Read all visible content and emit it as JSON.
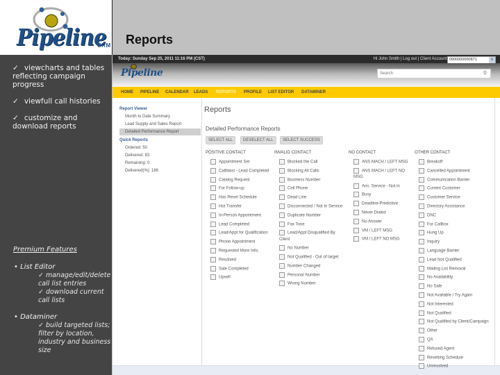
{
  "slide": {
    "title": "Reports",
    "logo": {
      "word": "Pipeline",
      "suffix": "CRM"
    },
    "bullets": [
      {
        "check": "✓",
        "text": "viewcharts and tables reflecting campaign progress"
      },
      {
        "check": "✓",
        "text": "viewfull call histories"
      },
      {
        "check": "✓",
        "text": "customize and download reports"
      }
    ],
    "premium": {
      "heading": "Premium Features",
      "items": [
        {
          "label": "List Editor",
          "subs": [
            "✓ manage/edit/delete call list entries",
            "✓ download current call lists"
          ]
        },
        {
          "label": "Dataminer",
          "subs": [
            "✓ build targeted lists; filter by location, industry and business size"
          ]
        }
      ]
    }
  },
  "app": {
    "topbar": {
      "date": "Today: Sunday Sep 25, 2011 11:16 PM (CST)",
      "user": "Hi John Smith | Log out | Client Account:",
      "account_value": "0900000000871",
      "account_arrow": "v"
    },
    "logo": "Pipeline",
    "search": {
      "placeholder": "Search",
      "icon": "⚲"
    },
    "nav": {
      "items": [
        "HOME",
        "PIPELINE",
        "CALENDAR",
        "LEADS",
        "REPORTS",
        "PROFILE",
        "LIST EDITOR",
        "DATAMINER"
      ],
      "active": "REPORTS"
    },
    "sidebar": {
      "report_viewer": {
        "heading": "Report Viewer",
        "items": [
          "Month to Date Summary",
          "Lead Supply and Sales Report",
          "Detailed Performance Report"
        ],
        "selected": "Detailed Performance Report"
      },
      "quick_reports": {
        "heading": "Quick Reports",
        "items": [
          "Ordered: 50",
          "Delivered: 93",
          "Remaining: 0",
          "Delivered(%): 186"
        ]
      }
    },
    "main": {
      "title": "Reports",
      "section_title": "Detailed Performance Reports",
      "buttons": [
        "SELECT ALL",
        "DESELECT ALL",
        "SELECT SUCCESS"
      ],
      "columns": [
        {
          "heading": "POSITIVE CONTACT",
          "items": [
            "Appointment Set",
            "Callblast - Lead Completed",
            "Catalog Request",
            "For Follow-up",
            "Has Reset Schedule",
            "Hot Transfer",
            "In-Person Appointment",
            "Lead Completed",
            "Lead/Appt for Qualification",
            "Phone Appointment",
            "Requested More Info.",
            "Resolved",
            "Sale Completed",
            "Upsell"
          ]
        },
        {
          "heading": "INVALID CONTACT",
          "items": [
            "Blocked the Call",
            "Blocking All Calls",
            "Business Number",
            "Cell Phone",
            "Dead Line",
            "Disconnected / Not In Service",
            "Duplicate Number",
            "Fax Tone",
            "Lead/Appt Disqualified By Client",
            "No Number",
            "Not Qualified - Out of target",
            "Number Changed",
            "Personal Number",
            "Wrong Number"
          ]
        },
        {
          "heading": "NO CONTACT",
          "items": [
            "ANS MACH / LEFT MSG",
            "ANS MACH / LEFT NO MSG",
            "Ans. Service - Not in",
            "Busy",
            "Deadline-Predictive",
            "Never Dialed",
            "No Answer",
            "VM / LEFT MSG",
            "VM / LEFT NO MSG"
          ]
        },
        {
          "heading": "OTHER CONTACT",
          "items": [
            "Breakoff",
            "Cancelled Appointment",
            "Communication Barrier",
            "Current Customer",
            "Customer Service",
            "Directory Assistance",
            "DNC",
            "For Callbox",
            "Hung Up",
            "Inquiry",
            "Language Barrier",
            "Lead Not Qualified",
            "Mailing List Removal",
            "No Availability",
            "No Sale",
            "Not Available / Try Again",
            "Not Interested",
            "Not Qualified",
            "Not Qualified by Client/Campaign",
            "Other",
            "QA",
            "Refused Agent",
            "Resetting Schedule",
            "Unresolved"
          ]
        }
      ]
    }
  }
}
